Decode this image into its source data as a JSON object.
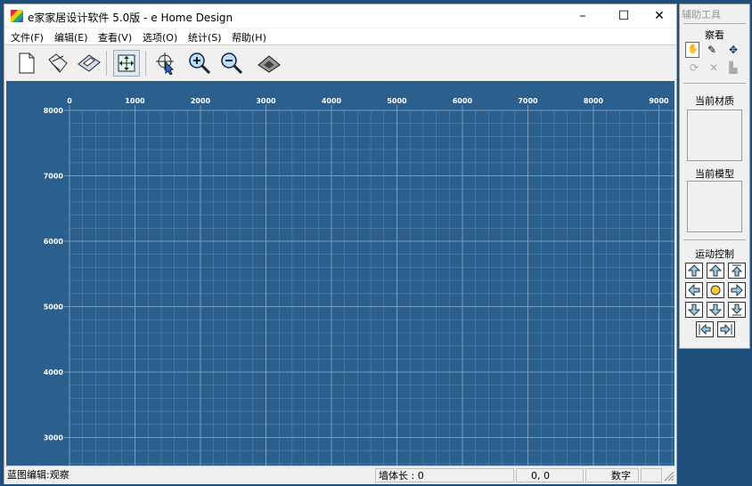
{
  "window": {
    "title": "e家家居设计软件 5.0版 - e Home Design",
    "minimize": "–",
    "maximize": "☐",
    "close": "✕"
  },
  "menu": [
    "文件(F)",
    "编辑(E)",
    "查看(V)",
    "选项(O)",
    "统计(S)",
    "帮助(H)"
  ],
  "toolbar": {
    "icons": [
      "new-file-icon",
      "open-folder-icon",
      "save-disk-icon",
      "pan-move-icon",
      "select-pointer-icon",
      "zoom-in-icon",
      "zoom-out-icon",
      "view-3d-house-icon"
    ],
    "pressed": [
      "pan-move-icon"
    ]
  },
  "canvas": {
    "background": "#2a5f8e",
    "grid_color": "#7fa3c4",
    "x_labels": [
      "0",
      "1000",
      "2000",
      "3000",
      "4000",
      "5000",
      "6000",
      "7000",
      "8000",
      "9000"
    ],
    "y_labels": [
      "8000",
      "7000",
      "6000",
      "5000",
      "4000",
      "3000"
    ]
  },
  "status": {
    "mode": "蓝图编辑:观察",
    "wall_length": "墙体长 : 0",
    "coords": "0,   0",
    "numlock": "数字"
  },
  "aux": {
    "title": "辅助工具",
    "view_heading": "察看",
    "material_heading": "当前材质",
    "model_heading": "当前模型",
    "motion_heading": "运动控制"
  }
}
